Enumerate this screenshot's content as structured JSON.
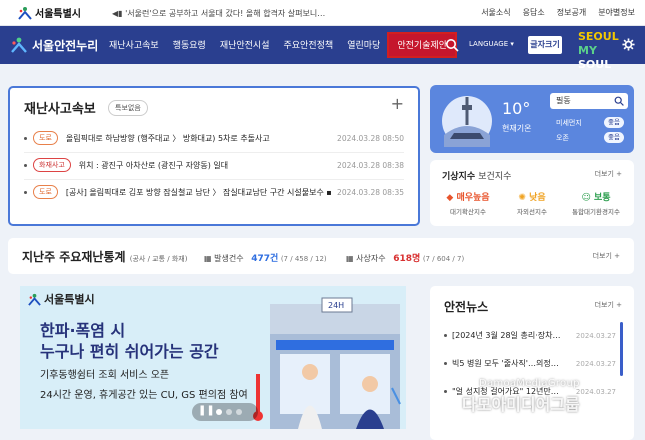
{
  "topbar": {
    "logo": "서울특별시",
    "notice": "'서울런'으로 공부하고 서울대 갔다! 올해 합격자 살펴보니…",
    "links": [
      "서울소식",
      "응답소",
      "정보공개",
      "분야별정보"
    ]
  },
  "nav": {
    "brand": "서울안전누리",
    "items": [
      "재난사고속보",
      "행동요령",
      "재난안전시설",
      "주요안전정책",
      "열린마당",
      "안전기술제안"
    ],
    "language": "LANGUAGE",
    "bigfont": "글자크기",
    "myseoul": [
      "SEOUL",
      "MY",
      "SOUL"
    ]
  },
  "disaster": {
    "title": "재난사고속보",
    "badge": "특보없음",
    "rows": [
      {
        "tag": "도로",
        "text": "올림픽대로 하남방향 (행주대교 〉 방화대교) 5차로 추돌사고",
        "date": "2024.03.28 08:50"
      },
      {
        "tag": "화재사고",
        "text": "위치 : 광진구 아차산로 (광진구 자양동) 일대",
        "date": "2024.03.28 08:38"
      },
      {
        "tag": "도로",
        "text": "[공사] 올림픽대로 김포 방향 잠실철교 남단 〉 잠실대교남단 구간 시설물보수 ▪ …",
        "date": "2024.03.28 08:35"
      }
    ]
  },
  "weather": {
    "temp": "10°",
    "condition": "현재기온",
    "district": "필동",
    "aq": [
      {
        "label": "미세먼지",
        "value": "좋음"
      },
      {
        "label": "오존",
        "value": "좋음"
      }
    ]
  },
  "climate": {
    "title": "기상지수",
    "subtitle": "보건지수",
    "more": "더보기 +",
    "items": [
      {
        "value": "매우높음",
        "label": "대기확산지수",
        "color": "#e8542c"
      },
      {
        "value": "낮음",
        "label": "자외선지수",
        "color": "#f0a322"
      },
      {
        "value": "보통",
        "label": "통합대기환경지수",
        "color": "#2c9e4e"
      }
    ]
  },
  "weekly": {
    "title": "지난주 주요재난통계",
    "note": "(공사 / 교통 / 화재)",
    "stat1_label": "발생건수",
    "stat1_value": "477건",
    "stat1_detail": "(7 / 458 / 12)",
    "stat2_label": "사상자수",
    "stat2_value": "618명",
    "stat2_detail": "(7 / 604 / 7)",
    "more": "더보기 +"
  },
  "banner": {
    "logo": "서울특별시",
    "headline1": "한파·폭염 시",
    "headline2": "누구나 편히 쉬어가는 공간",
    "sub1": "기후동행쉼터 조회 서비스 오픈",
    "sub2": "24시간 운영, 휴게공간 있는 CU, GS 편의점 참여",
    "sign": "24H"
  },
  "news": {
    "title": "안전뉴스",
    "more": "더보기 +",
    "rows": [
      {
        "text": "[2024년 3월 28일 총리·장차…",
        "date": "2024.03.27"
      },
      {
        "text": "빅5 병원 모두 '줄사직'…의정…",
        "date": "2024.03.27"
      },
      {
        "text": "\"얼 성지청 걸어가요\" 12년만…",
        "date": "2024.03.27"
      }
    ]
  },
  "watermark": {
    "en": "DamoaMediaGroup",
    "kr": "다모아미디어그룹"
  }
}
